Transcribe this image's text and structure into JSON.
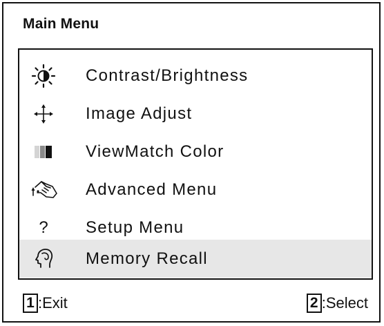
{
  "menu": {
    "title": "Main Menu",
    "items": [
      {
        "label": "Contrast/Brightness",
        "icon": "brightness-contrast-icon"
      },
      {
        "label": "Image Adjust",
        "icon": "move-arrows-icon"
      },
      {
        "label": "ViewMatch Color",
        "icon": "color-bars-icon"
      },
      {
        "label": "Advanced Menu",
        "icon": "hand-pointer-icon"
      },
      {
        "label": "Setup Menu",
        "icon": "question-icon"
      },
      {
        "label": "Memory Recall",
        "icon": "head-profile-icon",
        "selected": true
      }
    ],
    "question_glyph": "?"
  },
  "footer": {
    "exit_key": "1",
    "exit_label": ":Exit",
    "select_key": "2",
    "select_label": ":Select"
  }
}
